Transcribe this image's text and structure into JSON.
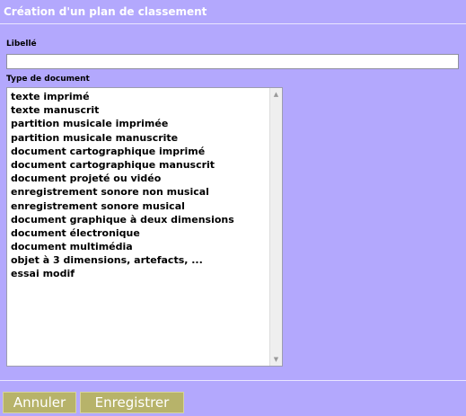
{
  "header": {
    "title": "Création d'un plan de classement"
  },
  "form": {
    "libelle": {
      "label": "Libellé",
      "value": "",
      "placeholder": ""
    },
    "type_document": {
      "label": "Type de document",
      "options": [
        "texte imprimé",
        "texte manuscrit",
        "partition musicale imprimée",
        "partition musicale manuscrite",
        "document cartographique imprimé",
        "document cartographique manuscrit",
        "document projeté ou vidéo",
        "enregistrement sonore non musical",
        "enregistrement sonore musical",
        "document graphique à deux dimensions",
        "document électronique",
        "document multimédia",
        "objet à 3 dimensions, artefacts, ...",
        "essai modif"
      ],
      "scroll_up_icon": "triangle-up-icon",
      "scroll_down_icon": "triangle-down-icon"
    }
  },
  "actions": {
    "cancel_label": "Annuler",
    "save_label": "Enregistrer"
  },
  "colors": {
    "background": "#b3a8fd",
    "button": "#b7b36a",
    "divider": "#e9e5ff"
  }
}
